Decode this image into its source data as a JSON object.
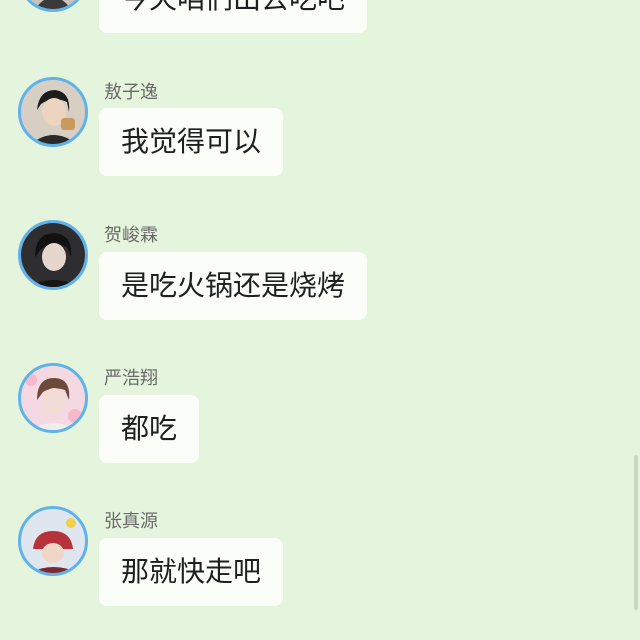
{
  "messages": [
    {
      "sender": "",
      "text": "今天咱们出去吃吧",
      "avatar_icon": "avatar-icon"
    },
    {
      "sender": "敖子逸",
      "text": "我觉得可以",
      "avatar_icon": "avatar-icon"
    },
    {
      "sender": "贺峻霖",
      "text": "是吃火锅还是烧烤",
      "avatar_icon": "avatar-icon"
    },
    {
      "sender": "严浩翔",
      "text": "都吃",
      "avatar_icon": "avatar-icon"
    },
    {
      "sender": "张真源",
      "text": "那就快走吧",
      "avatar_icon": "avatar-icon"
    }
  ],
  "colors": {
    "background": "#e5f4dd",
    "bubble": "#fbfdf9",
    "avatar_ring": "#5fb2ea",
    "name_text": "#6a6a6a"
  }
}
